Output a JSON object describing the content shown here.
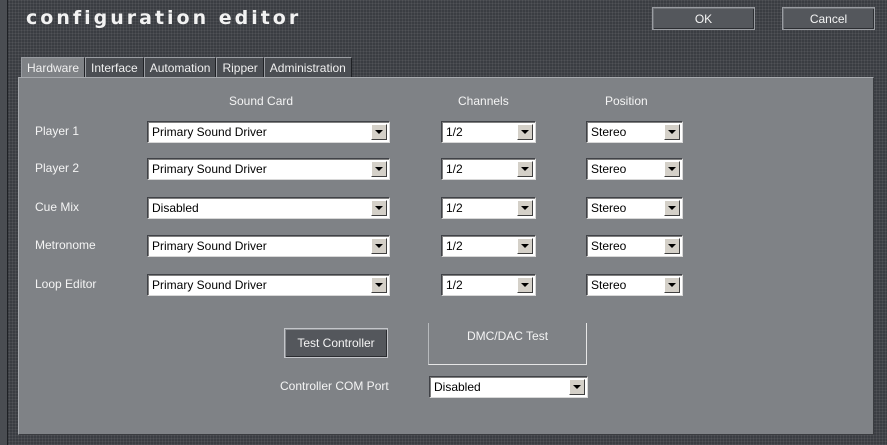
{
  "window": {
    "title": "configuration editor",
    "ok_label": "OK",
    "cancel_label": "Cancel"
  },
  "tabs": [
    {
      "label": "Hardware",
      "active": true
    },
    {
      "label": "Interface",
      "active": false
    },
    {
      "label": "Automation",
      "active": false
    },
    {
      "label": "Ripper",
      "active": false
    },
    {
      "label": "Administration",
      "active": false
    }
  ],
  "columns": {
    "sound_card": "Sound Card",
    "channels": "Channels",
    "position": "Position"
  },
  "rows": [
    {
      "label": "Player 1",
      "sound_card": "Primary Sound Driver",
      "channels": "1/2",
      "position": "Stereo"
    },
    {
      "label": "Player 2",
      "sound_card": "Primary Sound Driver",
      "channels": "1/2",
      "position": "Stereo"
    },
    {
      "label": "Cue Mix",
      "sound_card": "Disabled",
      "channels": "1/2",
      "position": "Stereo"
    },
    {
      "label": "Metronome",
      "sound_card": "Primary Sound Driver",
      "channels": "1/2",
      "position": "Stereo"
    },
    {
      "label": "Loop Editor",
      "sound_card": "Primary Sound Driver",
      "channels": "1/2",
      "position": "Stereo"
    }
  ],
  "controller": {
    "test_button": "Test Controller",
    "dmc_label": "DMC/DAC Test",
    "com_port_label": "Controller COM Port",
    "com_port_value": "Disabled"
  },
  "icons": {
    "dropdown": "chevron-down-icon"
  }
}
